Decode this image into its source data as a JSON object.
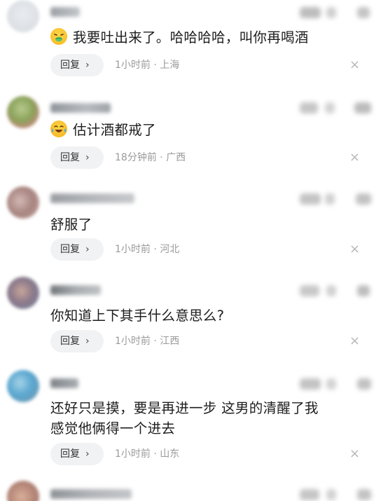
{
  "comments": [
    {
      "content": "我要吐出来了。哈哈哈哈，叫你再喝酒",
      "emoji": "vomiting-face",
      "reply_label": "回复",
      "time": "1小时前",
      "location": "上海",
      "close": "×"
    },
    {
      "content": "估计酒都戒了",
      "emoji": "crying-laughing-face",
      "reply_label": "回复",
      "time": "18分钟前",
      "location": "广西",
      "close": "×"
    },
    {
      "content": "舒服了",
      "reply_label": "回复",
      "time": "1小时前",
      "location": "河北",
      "close": "×"
    },
    {
      "content": "你知道上下其手什么意思么?",
      "reply_label": "回复",
      "time": "1小时前",
      "location": "江西",
      "close": "×"
    },
    {
      "content_line1": "还好只是摸，要是再进一步 这男的清醒了我",
      "content_line2": "感觉他俩得一个进去",
      "reply_label": "回复",
      "time": "1小时前",
      "location": "山东",
      "close": "×"
    }
  ],
  "separator": " · ",
  "reply_chevron": "›"
}
